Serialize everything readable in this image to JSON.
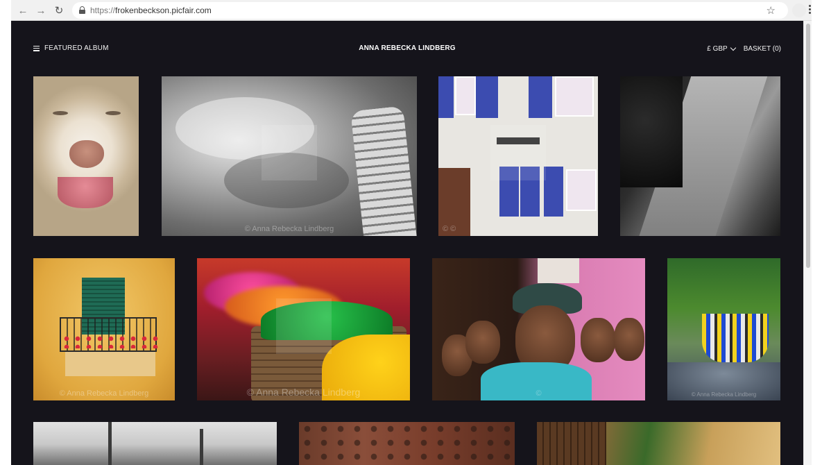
{
  "browser": {
    "url_scheme": "https://",
    "url_host": "frokenbeckson.picfair.com"
  },
  "header": {
    "menu_label": "FEATURED ALBUM",
    "site_title": "ANNA REBECKA LINDBERG",
    "currency": "£ GBP",
    "basket": "BASKET (0)"
  },
  "photos": [
    {
      "name": "dog",
      "watermark": ""
    },
    {
      "name": "leaning-tower",
      "watermark": "© Anna Rebecka Lindberg"
    },
    {
      "name": "facade-blue-shutters",
      "watermark": "© ©"
    },
    {
      "name": "street-shadows",
      "watermark": ""
    },
    {
      "name": "balcony-woman",
      "watermark": "© Anna Rebecka Lindberg"
    },
    {
      "name": "color-powder",
      "watermark": "© Anna Rebecka Lindberg"
    },
    {
      "name": "men-portrait",
      "watermark": "©"
    },
    {
      "name": "fishing-lures",
      "watermark": "© Anna Rebecka Lindberg"
    },
    {
      "name": "fence-landscape",
      "watermark": ""
    },
    {
      "name": "wooden-door",
      "watermark": ""
    },
    {
      "name": "canyon",
      "watermark": ""
    }
  ]
}
